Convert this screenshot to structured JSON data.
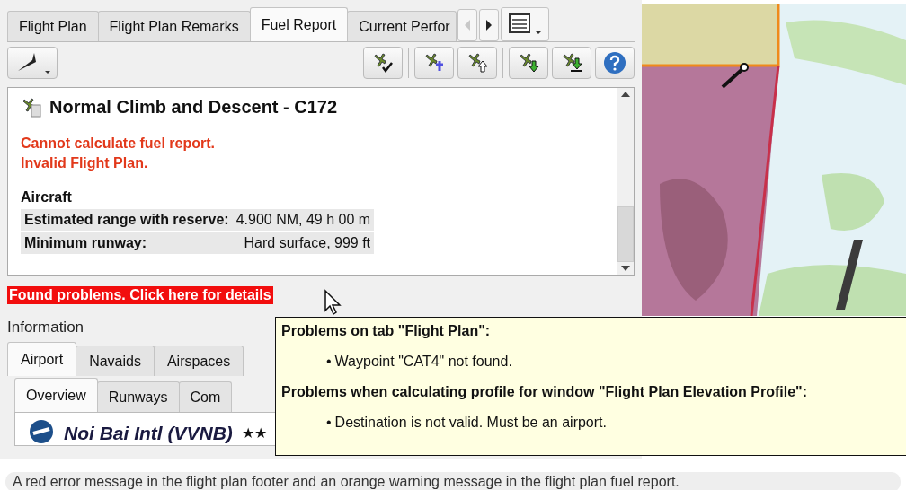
{
  "top_tabs": [
    {
      "label": "Flight Plan",
      "selected": false
    },
    {
      "label": "Flight Plan Remarks",
      "selected": false
    },
    {
      "label": "Fuel Report",
      "selected": true
    },
    {
      "label": "Current Perfor",
      "selected": false
    }
  ],
  "tab_scroll": [
    {
      "disabled": true
    },
    {
      "disabled": false
    }
  ],
  "report": {
    "title": "Normal Climb and Descent - C172",
    "errors": [
      "Cannot calculate fuel report.",
      "Invalid Flight Plan."
    ],
    "section": "Aircraft",
    "rows": [
      {
        "label": "Estimated range with reserve:",
        "value": "4.900 NM, 49 h 00 m"
      },
      {
        "label": "Minimum runway:",
        "value": "Hard surface, 999 ft"
      }
    ]
  },
  "error_banner": "Found problems. Click here for details",
  "information": {
    "title": "Information",
    "tabs": [
      {
        "label": "Airport",
        "selected": true
      },
      {
        "label": "Navaids",
        "selected": false
      },
      {
        "label": "Airspaces",
        "selected": false
      }
    ],
    "subtabs": [
      {
        "label": "Overview",
        "selected": true
      },
      {
        "label": "Runways",
        "selected": false
      },
      {
        "label": "Com",
        "selected": false
      }
    ],
    "airport_name": "Noi Bai Intl (VVNB)",
    "stars": "★★"
  },
  "tooltip": {
    "sections": [
      {
        "heading": "Problems on tab \"Flight Plan\":",
        "items": [
          {
            "bullet": "•",
            "text": "Waypoint \"CAT4\" not found."
          }
        ]
      },
      {
        "heading": "Problems when calculating profile for window \"Flight Plan Elevation Profile\":",
        "items": [
          {
            "bullet": "•",
            "text": "Destination is not valid. Must be an airport."
          }
        ]
      }
    ]
  },
  "caption": "A red error message in the flight plan footer and an orange warning message in the flight plan fuel report."
}
